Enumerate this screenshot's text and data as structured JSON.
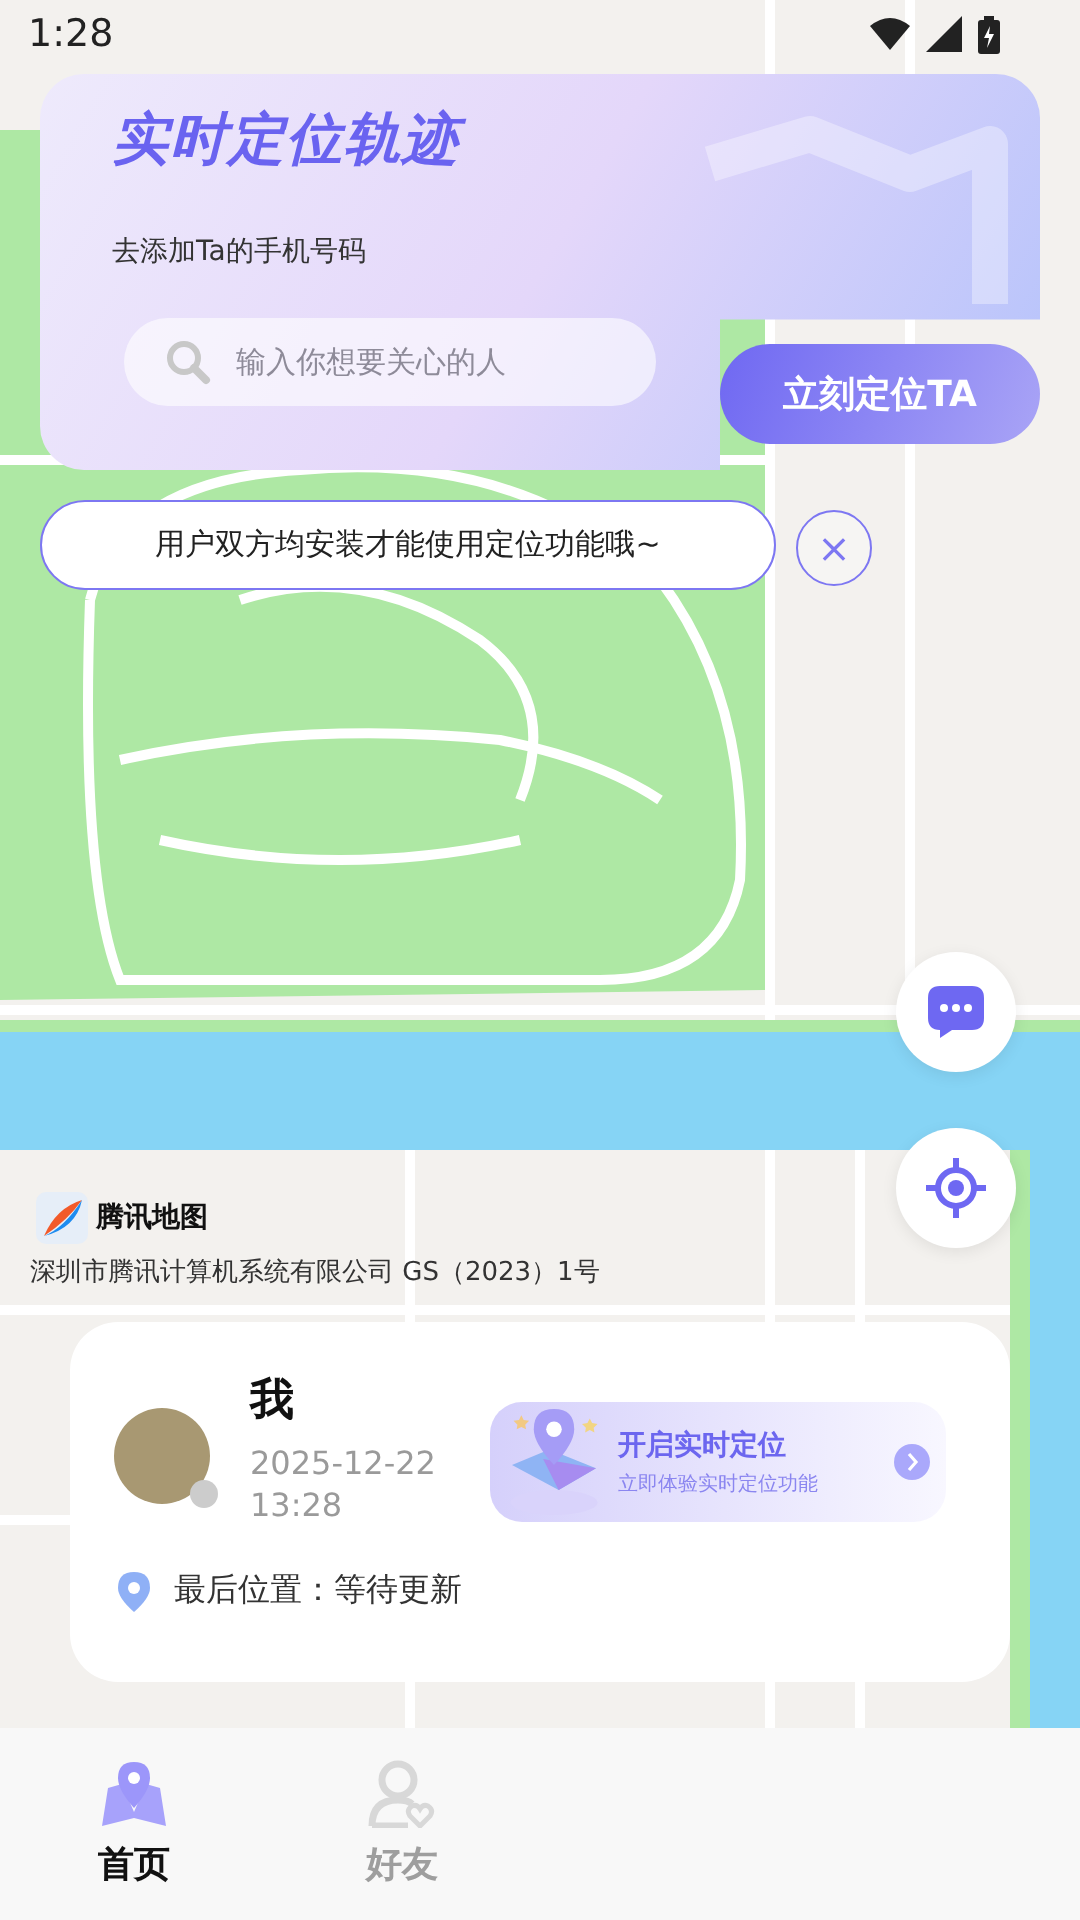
{
  "status_bar": {
    "time": "1:28"
  },
  "header_card": {
    "title": "实时定位轨迹",
    "subtitle": "去添加Ta的手机号码",
    "search": {
      "placeholder": "输入你想要关心的人"
    },
    "locate_button": "立刻定位TA"
  },
  "notice": {
    "text": "用户双方均安装才能使用定位功能哦~",
    "close": "×"
  },
  "map": {
    "logo_text": "腾讯地图",
    "attribution": "深圳市腾讯计算机系统有限公司 GS（2023）1号"
  },
  "user_card": {
    "name": "我",
    "datetime": "2025-12-22 13:28",
    "online": false,
    "promo": {
      "title": "开启实时定位",
      "subtitle": "立即体验实时定位功能"
    },
    "last_location": "最后位置：等待更新"
  },
  "tabs": [
    {
      "label": "首页",
      "selected": true
    },
    {
      "label": "好友",
      "selected": false
    }
  ]
}
